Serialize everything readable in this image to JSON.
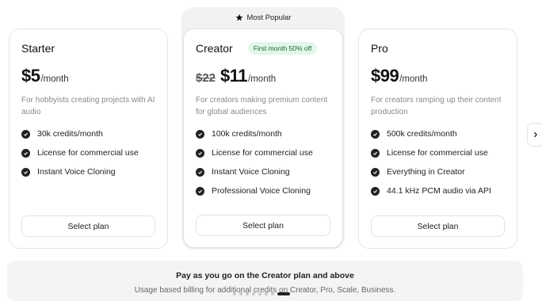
{
  "popular_label": "Most Popular",
  "plans": [
    {
      "name": "Starter",
      "price": "$5",
      "period": "/month",
      "description": "For hobbyists creating projects with AI audio",
      "features": [
        "30k credits/month",
        "License for commercial use",
        "Instant Voice Cloning"
      ],
      "button": "Select plan"
    },
    {
      "name": "Creator",
      "badge": "First month 50% off",
      "old_price": "$22",
      "price": "$11",
      "period": "/month",
      "description": "For creators making premium content for global audiences",
      "features": [
        "100k credits/month",
        "License for commercial use",
        "Instant Voice Cloning",
        "Professional Voice Cloning"
      ],
      "button": "Select plan"
    },
    {
      "name": "Pro",
      "price": "$99",
      "period": "/month",
      "description": "For creators ramping up their content production",
      "features": [
        "500k credits/month",
        "License for commercial use",
        "Everything in Creator",
        "44.1 kHz PCM audio via API"
      ],
      "button": "Select plan"
    }
  ],
  "next_arrow_icon": "chevron-right-icon",
  "payg": {
    "title": "Pay as you go on the Creator plan and above",
    "subtitle": "Usage based billing for additional credits on Creator, Pro, Scale, Business."
  },
  "carousel": {
    "total_dots": 8,
    "active_index": 7
  }
}
